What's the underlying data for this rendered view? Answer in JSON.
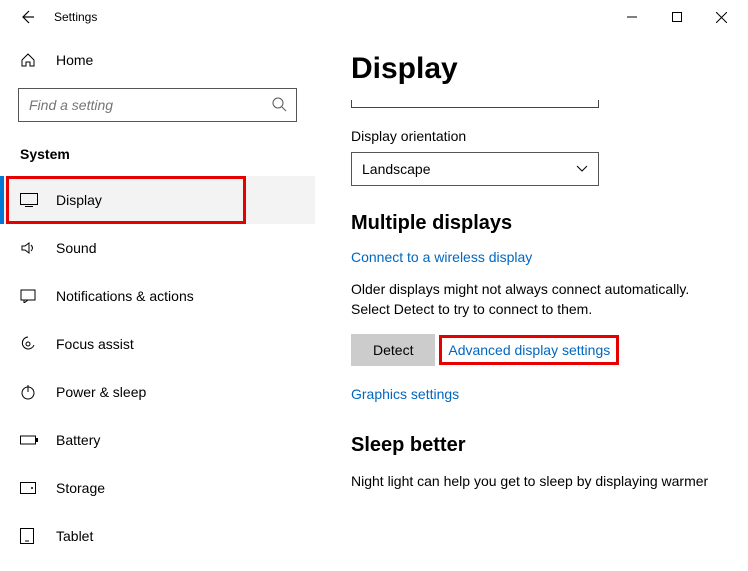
{
  "titlebar": {
    "title": "Settings"
  },
  "sidebar": {
    "home": "Home",
    "search_placeholder": "Find a setting",
    "category": "System",
    "items": [
      {
        "label": "Display",
        "icon": "display-icon",
        "active": true
      },
      {
        "label": "Sound",
        "icon": "sound-icon"
      },
      {
        "label": "Notifications & actions",
        "icon": "notifications-icon"
      },
      {
        "label": "Focus assist",
        "icon": "focus-assist-icon"
      },
      {
        "label": "Power & sleep",
        "icon": "power-icon"
      },
      {
        "label": "Battery",
        "icon": "battery-icon"
      },
      {
        "label": "Storage",
        "icon": "storage-icon"
      },
      {
        "label": "Tablet",
        "icon": "tablet-icon"
      }
    ]
  },
  "main": {
    "heading": "Display",
    "orientation_label": "Display orientation",
    "orientation_value": "Landscape",
    "multiple_heading": "Multiple displays",
    "wireless_link": "Connect to a wireless display",
    "older_text": "Older displays might not always connect automatically. Select Detect to try to connect to them.",
    "detect_button": "Detect",
    "advanced_link": "Advanced display settings",
    "graphics_link": "Graphics settings",
    "sleep_heading": "Sleep better",
    "sleep_text": "Night light can help you get to sleep by displaying warmer"
  }
}
